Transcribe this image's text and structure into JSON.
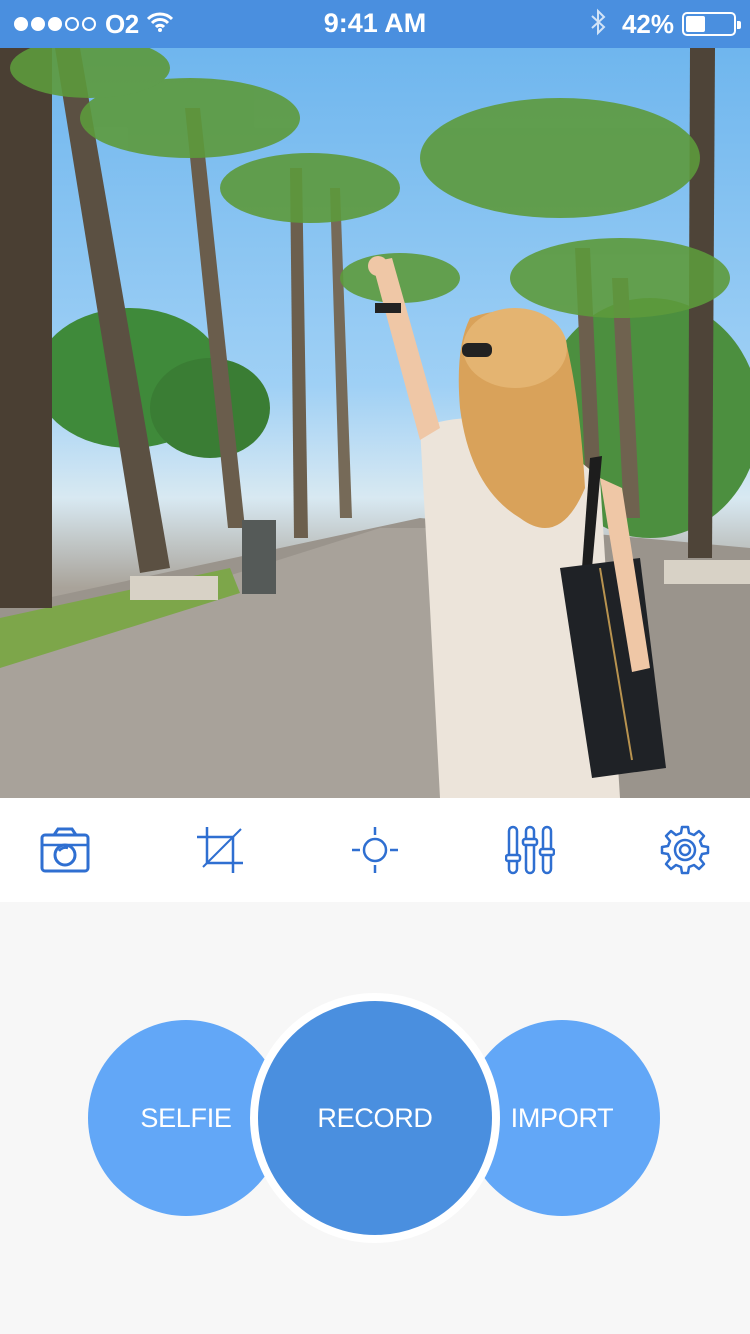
{
  "status_bar": {
    "carrier": "O2",
    "time": "9:41 AM",
    "battery_percent": "42%",
    "battery_level": 0.42,
    "signal_bars_filled": 3,
    "signal_bars_total": 5
  },
  "colors": {
    "accent": "#4a8fdf",
    "accent_light": "#62a7f7",
    "icon": "#2f6fd1",
    "background": "#f7f7f7"
  },
  "toolbar": {
    "icons": [
      "camera-icon",
      "crop-icon",
      "brightness-icon",
      "sliders-icon",
      "gear-icon"
    ]
  },
  "actions": {
    "selfie_label": "SELFIE",
    "record_label": "RECORD",
    "import_label": "IMPORT"
  }
}
